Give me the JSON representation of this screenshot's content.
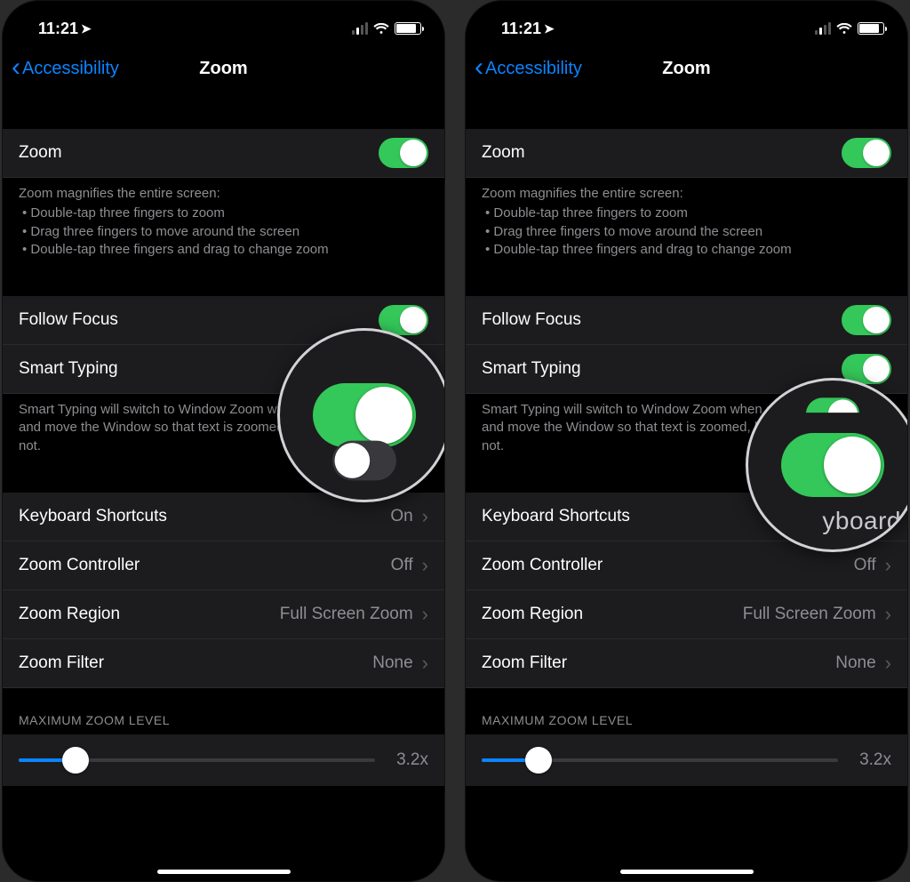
{
  "status": {
    "time": "11:21"
  },
  "nav": {
    "back": "Accessibility",
    "title": "Zoom"
  },
  "zoom": {
    "label": "Zoom",
    "on": true,
    "desc_title": "Zoom magnifies the entire screen:",
    "desc_bullets": [
      "Double-tap three fingers to zoom",
      "Drag three fingers to move around the screen",
      "Double-tap three fingers and drag to change zoom"
    ]
  },
  "follow_focus": {
    "label": "Follow Focus",
    "on": true
  },
  "smart_typing": {
    "label": "Smart Typing",
    "desc": "Smart Typing will switch to Window Zoom when a keyboard appears and move the Window so that text is zoomed, but the keyboard is not.",
    "on_left": false,
    "on_right": true
  },
  "rows": {
    "keyboard_shortcuts": {
      "label": "Keyboard Shortcuts",
      "value": "On"
    },
    "zoom_controller": {
      "label": "Zoom Controller",
      "value": "Off"
    },
    "zoom_region": {
      "label": "Zoom Region",
      "value": "Full Screen Zoom"
    },
    "zoom_filter": {
      "label": "Zoom Filter",
      "value": "None"
    }
  },
  "max_zoom": {
    "header": "MAXIMUM ZOOM LEVEL",
    "value_text": "3.2x",
    "fill_pct": 16
  },
  "magnifier_word": "yboard"
}
